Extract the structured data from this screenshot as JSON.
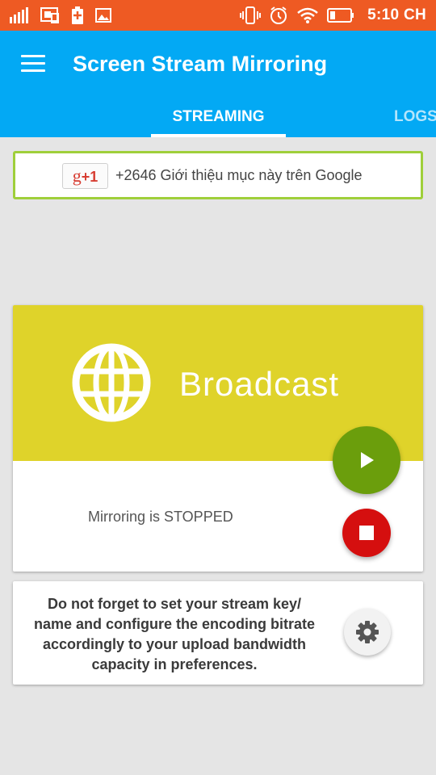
{
  "status_bar": {
    "time": "5:10 CH",
    "battery_level": "13",
    "icons": [
      "signal-icon",
      "screen-mirror-icon",
      "battery-charging-icon",
      "gallery-icon",
      "vibrate-icon",
      "alarm-icon",
      "wifi-icon",
      "battery-icon"
    ]
  },
  "app_bar": {
    "title": "Screen Stream Mirroring",
    "tabs": [
      {
        "label": "STREAMING",
        "active": true
      },
      {
        "label": "LOGS",
        "active": false
      }
    ]
  },
  "gplus": {
    "button_label": "g",
    "button_plus": "+1",
    "text": "+2646 Giới thiệu mục này trên Google"
  },
  "broadcast": {
    "title": "Broadcast",
    "status": "Mirroring is STOPPED"
  },
  "info": {
    "message": "Do not forget to set your stream key/ name and configure the encoding bitrate accordingly to your upload bandwidth capacity in preferences."
  },
  "colors": {
    "status_bar": "#ee5a23",
    "app_bar": "#03a9f4",
    "card_header": "#dfd32a",
    "play": "#6b9e0c",
    "stop": "#d50f0f",
    "gplus_border": "#9fcf3a"
  }
}
